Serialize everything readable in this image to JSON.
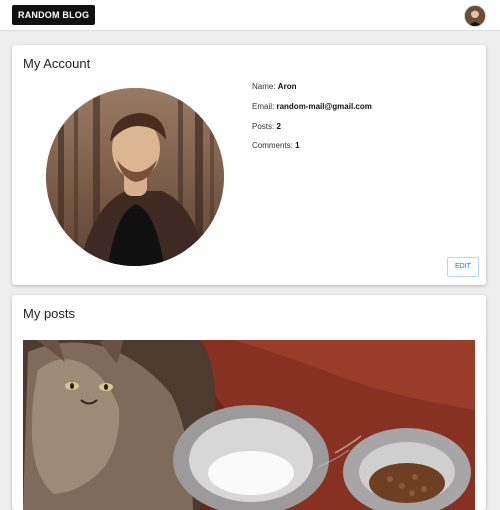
{
  "header": {
    "brand": "RANDOM BLOG"
  },
  "account": {
    "title": "My Account",
    "name_label": "Name:",
    "name_value": "Aron",
    "email_label": "Email:",
    "email_value": "random-mail@gmail.com",
    "posts_label": "Posts:",
    "posts_value": "2",
    "comments_label": "Comments:",
    "comments_value": "1",
    "edit_label": "EDIT"
  },
  "posts": {
    "title": "My posts"
  },
  "colors": {
    "accent": "#1976d2",
    "brand_bg": "#111111"
  }
}
